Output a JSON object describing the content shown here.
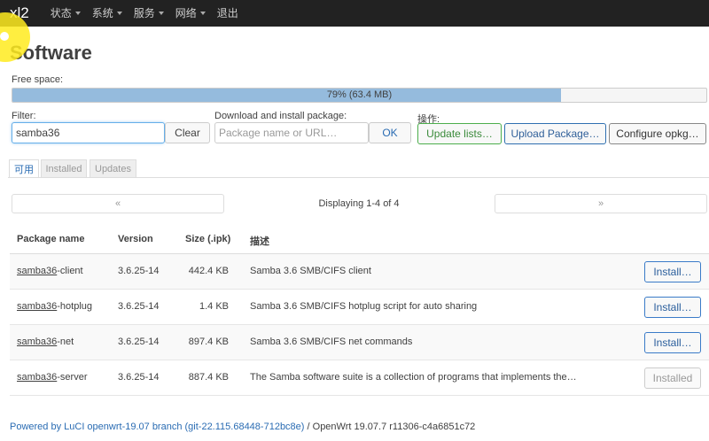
{
  "nav": {
    "brand": "xl2",
    "items": [
      {
        "label": "状态",
        "dropdown": true
      },
      {
        "label": "系统",
        "dropdown": true
      },
      {
        "label": "服务",
        "dropdown": true
      },
      {
        "label": "网络",
        "dropdown": true
      },
      {
        "label": "退出",
        "dropdown": false
      }
    ]
  },
  "page_title": "Software",
  "free_space": {
    "label": "Free space:",
    "percent": 79,
    "text": "79% (63.4 MB)"
  },
  "filter": {
    "label": "Filter:",
    "value": "samba36",
    "clear_label": "Clear"
  },
  "download": {
    "label": "Download and install package:",
    "placeholder": "Package name or URL…",
    "ok_label": "OK"
  },
  "actions": {
    "label": "操作:",
    "update_lists": "Update lists…",
    "upload_package": "Upload Package…",
    "configure": "Configure opkg…"
  },
  "tabs": [
    {
      "label": "可用",
      "active": true
    },
    {
      "label": "Installed",
      "active": false
    },
    {
      "label": "Updates",
      "active": false
    }
  ],
  "pager": {
    "prev": "«",
    "next": "»",
    "status": "Displaying 1-4 of 4"
  },
  "table": {
    "headers": [
      "Package name",
      "Version",
      "Size (.ipk)",
      "描述"
    ],
    "rows": [
      {
        "name_match": "samba36",
        "name_rest": "-client",
        "version": "3.6.25-14",
        "size": "442.4 KB",
        "description": "Samba 3.6 SMB/CIFS client",
        "action": "Install…",
        "installed": false
      },
      {
        "name_match": "samba36",
        "name_rest": "-hotplug",
        "version": "3.6.25-14",
        "size": "1.4 KB",
        "description": "Samba 3.6 SMB/CIFS hotplug script for auto sharing",
        "action": "Install…",
        "installed": false
      },
      {
        "name_match": "samba36",
        "name_rest": "-net",
        "version": "3.6.25-14",
        "size": "897.4 KB",
        "description": "Samba 3.6 SMB/CIFS net commands",
        "action": "Install…",
        "installed": false
      },
      {
        "name_match": "samba36",
        "name_rest": "-server",
        "version": "3.6.25-14",
        "size": "887.4 KB",
        "description": "The Samba software suite is a collection of programs that implements the…",
        "action": "Installed",
        "installed": true
      }
    ]
  },
  "footer": {
    "link": "Powered by LuCI openwrt-19.07 branch (git-22.115.68448-712bc8e)",
    "rest": " / OpenWrt 19.07.7 r11306-c4a6851c72"
  },
  "colors": {
    "navbar": "#222222",
    "progress_fill": "#95bbdd",
    "link": "#2a6cb3"
  }
}
